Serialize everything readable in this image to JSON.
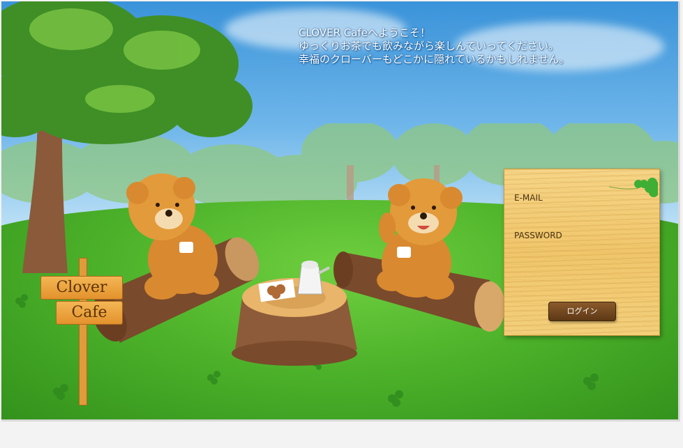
{
  "welcome": {
    "line1": "CLOVER Cafeへようこそ！",
    "line2": "ゆっくりお茶でも飲みながら楽しんでいってください。",
    "line3": "幸福のクローバーもどこかに隠れているかもしれません。"
  },
  "sign": {
    "line1": "Clover",
    "line2": "Cafe"
  },
  "login": {
    "email_label": "E-MAIL",
    "password_label": "PASSWORD",
    "email_value": "",
    "password_value": "",
    "button_label": "ログイン"
  },
  "icons": {
    "clover": "four-leaf-clover-icon"
  },
  "colors": {
    "sky": "#3a93d9",
    "grass": "#4db22a",
    "panel": "#f0c66b",
    "button": "#6b4219"
  }
}
